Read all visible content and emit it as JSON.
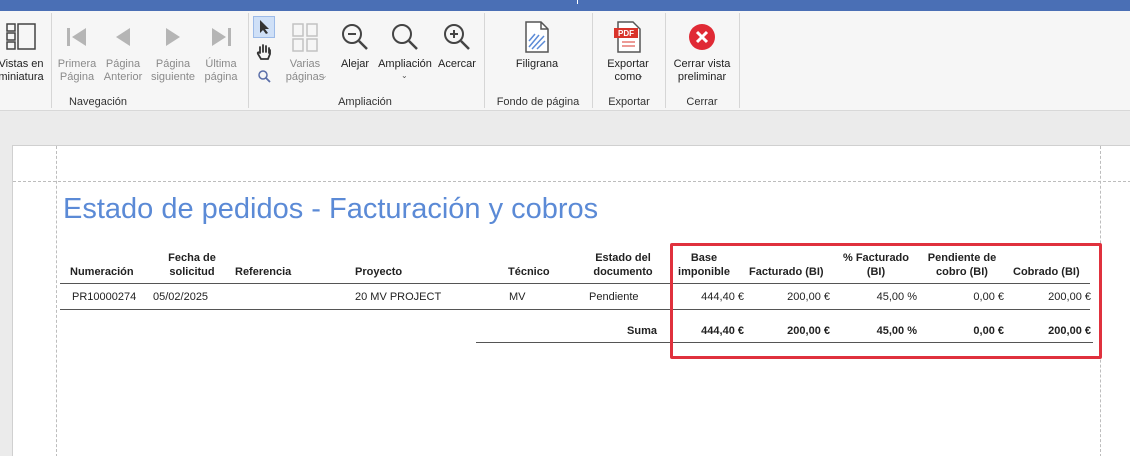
{
  "ribbon": {
    "groups": {
      "navegacion": "Navegación",
      "ampliacion": "Ampliación",
      "fondo": "Fondo de página",
      "exportar": "Exportar",
      "cerrar": "Cerrar"
    },
    "buttons": {
      "miniaturas": "Vistas en\nminiatura",
      "primera": "Primera\nPágina",
      "anterior": "Página\nAnterior",
      "siguiente": "Página\nsiguiente",
      "ultima": "Última\npágina",
      "varias": "Varias\npáginas",
      "alejar": "Alejar",
      "ampliacion": "Ampliación",
      "acercar": "Acercar",
      "filigrana": "Filigrana",
      "exportar": "Exportar\ncomo",
      "cerrar_vista": "Cerrar vista\npreliminar"
    },
    "pdf_badge": "PDF",
    "colors": {
      "accent": "#4a6fb5",
      "close_red": "#e02a35",
      "pdf_red": "#d9342b"
    }
  },
  "report": {
    "title": "Estado de pedidos - Facturación y cobros",
    "columns": {
      "numeracion": "Numeración",
      "fecha": "Fecha de\nsolicitud",
      "referencia": "Referencia",
      "proyecto": "Proyecto",
      "tecnico": "Técnico",
      "estado": "Estado del\ndocumento",
      "base": "Base\nimponible",
      "facturado": "Facturado (BI)",
      "pct": "% Facturado\n(BI)",
      "pendiente": "Pendiente de\ncobro (BI)",
      "cobrado": "Cobrado (BI)"
    },
    "rows": [
      {
        "numeracion": "PR10000274",
        "fecha": "05/02/2025",
        "referencia": "",
        "proyecto": "20 MV PROJECT",
        "tecnico": "MV",
        "estado": "Pendiente",
        "base": "444,40 €",
        "facturado": "200,00 €",
        "pct": "45,00 %",
        "pendiente": "0,00 €",
        "cobrado": "200,00 €"
      }
    ],
    "totals": {
      "label": "Suma",
      "base": "444,40 €",
      "facturado": "200,00 €",
      "pct": "45,00 %",
      "pendiente": "0,00 €",
      "cobrado": "200,00 €"
    },
    "colors": {
      "title": "#5b8ad6",
      "highlight": "#e0313d"
    }
  }
}
